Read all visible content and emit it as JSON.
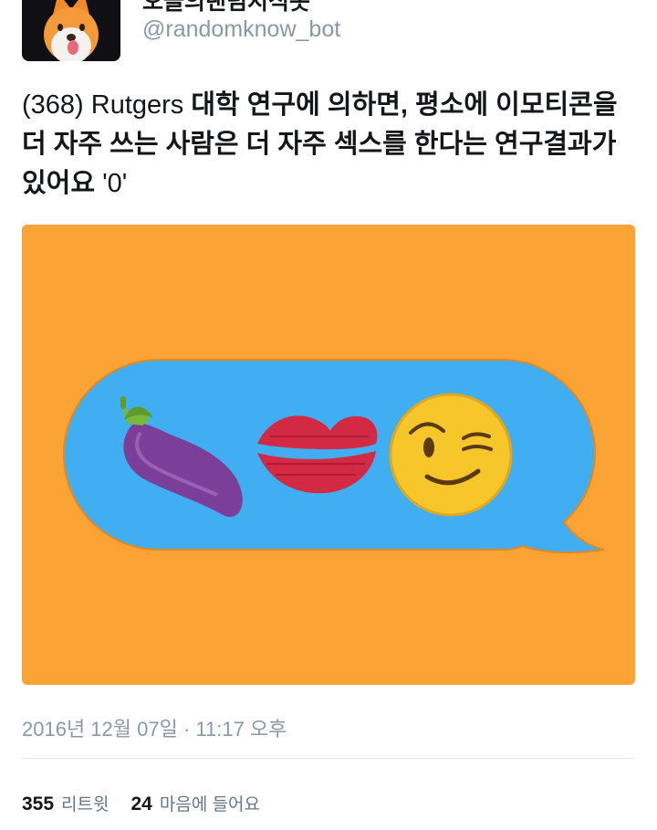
{
  "tweet": {
    "author": {
      "display_name": "오늘의랜덤지식봇",
      "handle": "@randomknow_bot",
      "avatar_icon": "fox-avatar-icon"
    },
    "text": {
      "number": "(368)",
      "latin": "Rutgers",
      "body": "대학 연구에 의하면, 평소에 이모티콘을 더 자주 쓰는 사람은 더 자주 섹스를 한다는 연구결과가 있어요",
      "emoticon": "'0'"
    },
    "media": {
      "background_color": "#fba334",
      "bubble_color": "#40aef0",
      "icons": [
        "eggplant-icon",
        "kiss-mark-icon",
        "winking-face-icon"
      ]
    },
    "timestamp": "2016년 12월 07일 · 11:17 오후",
    "stats": {
      "retweets": {
        "count": "355",
        "label": "리트윗"
      },
      "likes": {
        "count": "24",
        "label": "마음에 들어요"
      }
    }
  }
}
